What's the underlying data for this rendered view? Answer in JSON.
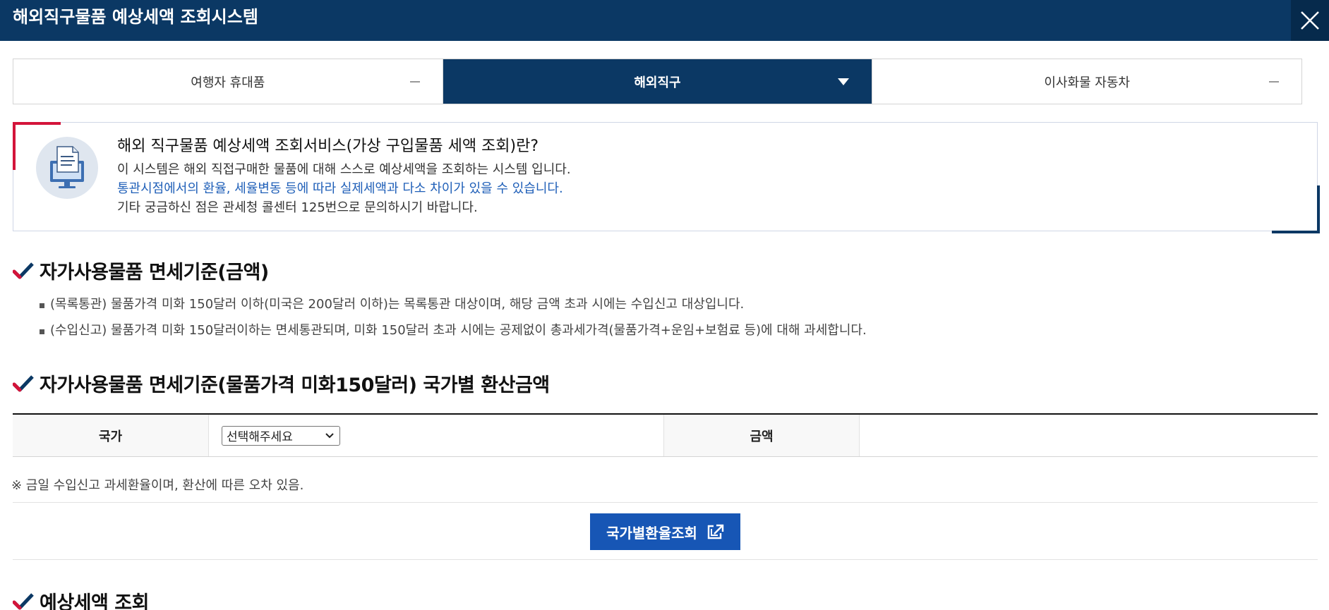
{
  "window": {
    "title": "해외직구물품 예상세액 조회시스템"
  },
  "tabs": [
    {
      "label": "여행자 휴대품",
      "indicator": "minus-icon"
    },
    {
      "label": "해외직구",
      "indicator": "caret-down-icon",
      "active": true
    },
    {
      "label": "이사화물 자동차",
      "indicator": "minus-icon"
    }
  ],
  "info": {
    "title": "해외 직구물품 예상세액 조회서비스(가상 구입물품 세액 조회)란?",
    "line1": "이 시스템은 해외 직접구매한 물품에 대해 스스로 예상세액을 조회하는 시스템 입니다.",
    "line2": "통관시점에서의 환율, 세율변동 등에 따라 실제세액과 다소 차이가 있을 수 있습니다.",
    "line3": "기타 궁금하신 점은 관세청 콜센터 125번으로 문의하시기 바랍니다.",
    "icon": "computer-document-icon"
  },
  "sections": {
    "exemption": {
      "title": "자가사용물품 면세기준(금액)",
      "bullets": [
        "(목록통관) 물품가격 미화 150달러 이하(미국은 200달러 이하)는 목록통관 대상이며, 해당 금액 초과 시에는 수입신고 대상입니다.",
        "(수입신고) 물품가격 미화 150달러이하는 면세통관되며, 미화 150달러 초과 시에는 공제없이 총과세가격(물품가격+운임+보험료 등)에 대해 과세합니다."
      ]
    },
    "conversion": {
      "title": "자가사용물품 면세기준(물품가격 미화150달러) 국가별 환산금액",
      "country_label": "국가",
      "country_select_value": "선택해주세요",
      "amount_label": "금액",
      "amount_value": "",
      "note": "※  금일 수입신고 과세환율이며, 환산에 따른 오차 있음.",
      "rate_button_label": "국가별환율조회"
    },
    "estimate": {
      "title": "예상세액 조회"
    }
  },
  "colors": {
    "navy": "#0b3864",
    "accent_red": "#d3143a",
    "button_blue": "#1756b5",
    "link_blue": "#1f5fb8"
  }
}
